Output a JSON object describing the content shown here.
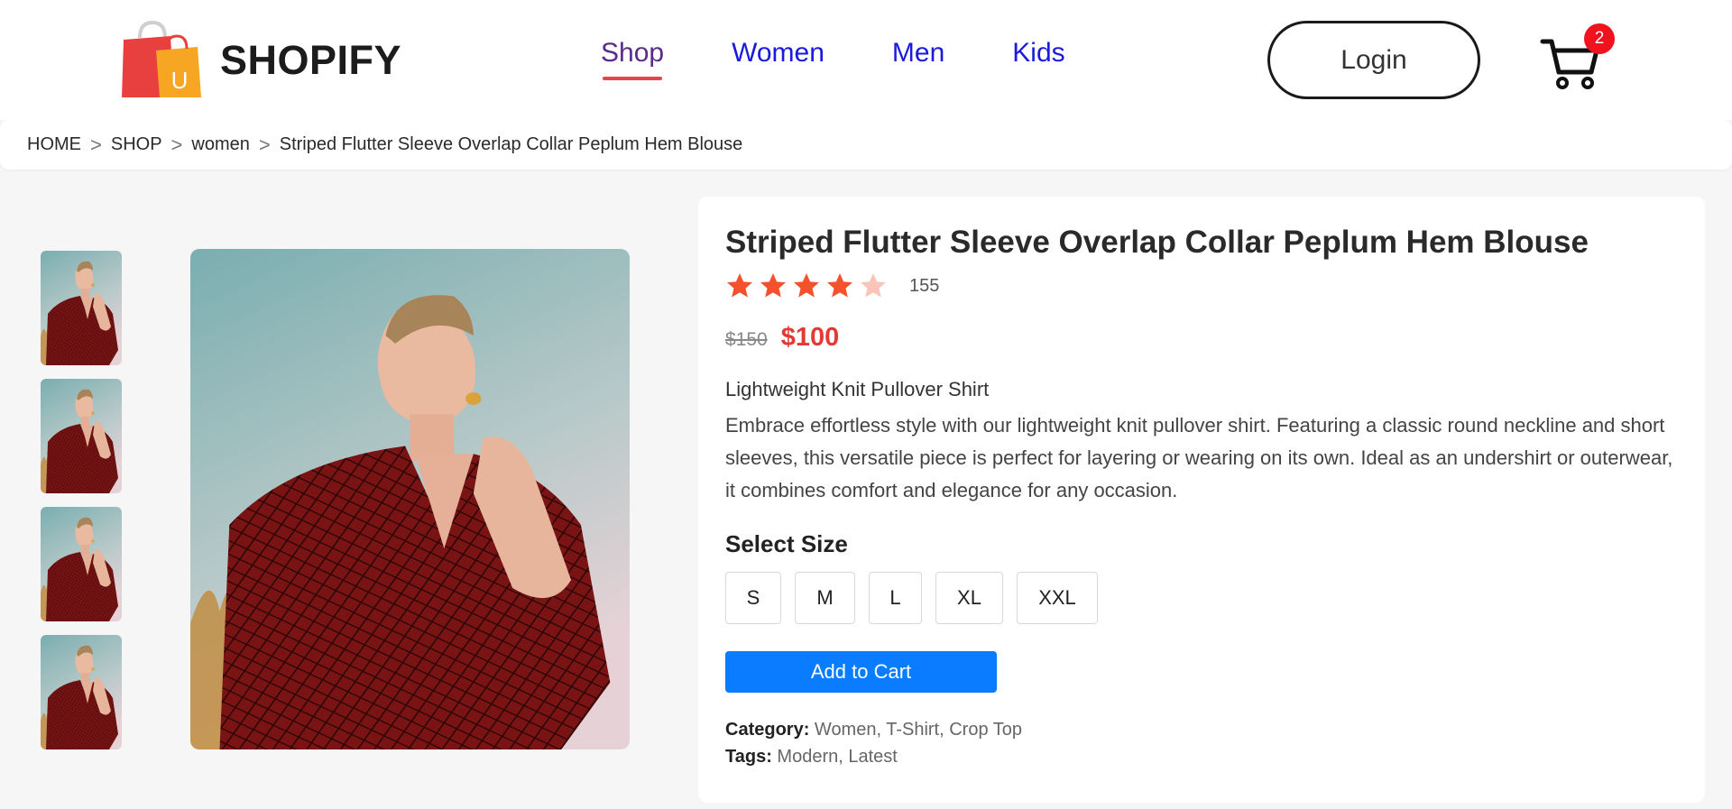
{
  "header": {
    "brand": "SHOPIFY",
    "logo_letter": "U",
    "nav": [
      "Shop",
      "Women",
      "Men",
      "Kids"
    ],
    "login_label": "Login",
    "cart_count": "2"
  },
  "breadcrumb": {
    "items": [
      "HOME",
      "SHOP",
      "women",
      "Striped Flutter Sleeve Overlap Collar Peplum Hem Blouse"
    ],
    "separator": ">"
  },
  "product": {
    "title": "Striped Flutter Sleeve Overlap Collar Peplum Hem Blouse",
    "rating": 4,
    "rating_max": 5,
    "review_count": "155",
    "old_price": "$150",
    "new_price": "$100",
    "subtitle": "Lightweight Knit Pullover Shirt",
    "description": "Embrace effortless style with our lightweight knit pullover shirt. Featuring a classic round neckline and short sleeves, this versatile piece is perfect for layering or wearing on its own. Ideal as an undershirt or outerwear, it combines comfort and elegance for any occasion.",
    "size_label": "Select Size",
    "sizes": [
      "S",
      "M",
      "L",
      "XL",
      "XXL"
    ],
    "add_to_cart_label": "Add to Cart",
    "category_label": "Category:",
    "category_value": "Women, T-Shirt, Crop Top",
    "tags_label": "Tags:",
    "tags_value": "Modern, Latest",
    "thumbnail_count": 4
  },
  "colors": {
    "accent_blue": "#0a7cff",
    "price_red": "#e53935",
    "star_filled": "#f4512c",
    "star_empty": "#fbc4b8",
    "nav_link": "#1a1adc",
    "badge_red": "#f0121c"
  }
}
